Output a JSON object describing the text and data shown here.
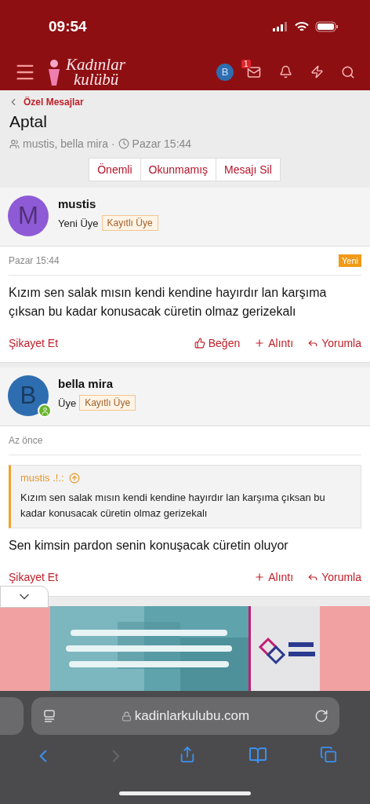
{
  "status_bar": {
    "time": "09:54"
  },
  "header": {
    "logo_top": "Kadınlar",
    "logo_bottom": "kulübü",
    "avatar_letter": "B",
    "inbox_badge": "1"
  },
  "breadcrumb": "Özel Mesajlar",
  "title": "Aptal",
  "meta": {
    "participants": "mustis, bella mira",
    "separator": "·",
    "time": "Pazar 15:44"
  },
  "actions": [
    "Önemli",
    "Okunmamış",
    "Mesajı Sil"
  ],
  "messages": [
    {
      "avatar_letter": "M",
      "color": "#8e5ad6",
      "online": false,
      "name": "mustis",
      "role": "Yeni Üye",
      "badge": "Kayıtlı Üye",
      "time": "Pazar 15:44",
      "new_label": "Yeni",
      "body": "Kızım sen salak mısın kendi kendine hayırdır lan karşıma çıksan bu kadar konusacak cüretin olmaz gerizekalı",
      "buttons": [
        {
          "kind": "report",
          "label": "Şikayet Et"
        },
        {
          "kind": "like",
          "label": "Beğen"
        },
        {
          "kind": "quote",
          "label": "Alıntı"
        },
        {
          "kind": "reply",
          "label": "Yorumla"
        }
      ]
    },
    {
      "avatar_letter": "B",
      "color": "#2e6db0",
      "online": true,
      "name": "bella mira",
      "role": "Üye",
      "badge": "Kayıtlı Üye",
      "time": "Az önce",
      "quote": {
        "author": "mustis .!.:",
        "text": "Kızım sen salak mısın kendi kendine hayırdır lan karşıma çıksan bu kadar konusacak cüretin olmaz gerizekalı"
      },
      "body": "Sen kimsin pardon senin konuşacak cüretin oluyor",
      "buttons": [
        {
          "kind": "report",
          "label": "Şikayet Et"
        },
        {
          "kind": "quote",
          "label": "Alıntı"
        },
        {
          "kind": "reply",
          "label": "Yorumla"
        }
      ]
    }
  ],
  "ad": {
    "kind": "picture"
  },
  "browser": {
    "url": "kadinlarkulubu.com"
  }
}
